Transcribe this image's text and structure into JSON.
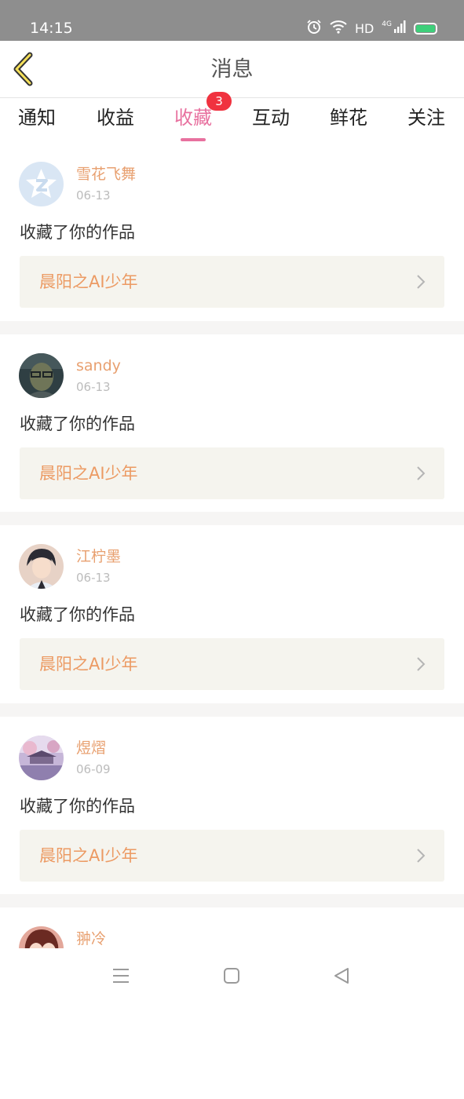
{
  "status_bar": {
    "time": "14:15",
    "hd": "HD",
    "network": "4G",
    "icons": [
      "alarm-icon",
      "wifi-icon",
      "signal-icon",
      "battery-icon"
    ],
    "battery_color": "#3ecf7a"
  },
  "header": {
    "title": "消息",
    "back_icon": "chevron-left-icon"
  },
  "tabs": {
    "items": [
      {
        "label": "通知"
      },
      {
        "label": "收益"
      },
      {
        "label": "收藏",
        "badge": "3",
        "active": true
      },
      {
        "label": "互动"
      },
      {
        "label": "鲜花"
      },
      {
        "label": "关注"
      }
    ],
    "active_color": "#e8719f",
    "badge_color": "#f0323f"
  },
  "feed": {
    "items": [
      {
        "name": "雪花飞舞",
        "date": "06-13",
        "action": "收藏了你的作品",
        "work": "晨阳之AI少年",
        "avatar": "default-avatar-icon"
      },
      {
        "name": "sandy",
        "date": "06-13",
        "action": "收藏了你的作品",
        "work": "晨阳之AI少年",
        "avatar": "user-photo"
      },
      {
        "name": "江柠墨",
        "date": "06-13",
        "action": "收藏了你的作品",
        "work": "晨阳之AI少年",
        "avatar": "anime-boy-avatar"
      },
      {
        "name": "煜熠",
        "date": "06-09",
        "action": "收藏了你的作品",
        "work": "晨阳之AI少年",
        "avatar": "landscape-avatar"
      },
      {
        "name": "翀冷",
        "avatar": "anime-girl-avatar"
      }
    ],
    "name_color": "#e8a070",
    "work_color": "#ec9a63"
  },
  "nav_bar": {
    "buttons": [
      "menu-icon",
      "home-icon",
      "back-triangle-icon"
    ]
  }
}
